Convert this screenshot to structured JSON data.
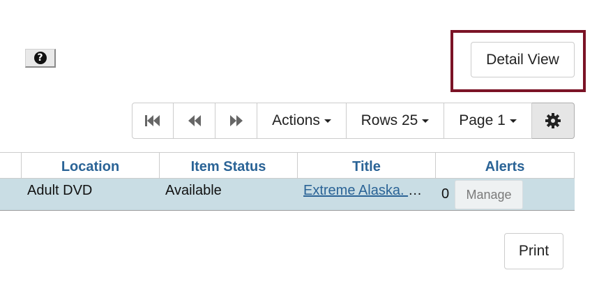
{
  "help": {
    "glyph": "?"
  },
  "detail_view": {
    "label": "Detail View"
  },
  "toolbar": {
    "first_icon": "first-page-icon",
    "prev_icon": "previous-page-icon",
    "next_icon": "next-page-icon",
    "actions_label": "Actions",
    "rows_label": "Rows 25",
    "page_label": "Page 1",
    "settings_icon": "gear-icon"
  },
  "grid": {
    "columns": [
      "Location",
      "Item Status",
      "Title",
      "Alerts"
    ],
    "rows": [
      {
        "location": "Adult DVD",
        "status": "Available",
        "title": "Extreme Alaska. ",
        "ellipsis": "…",
        "alerts": "0",
        "action": "Manage"
      }
    ]
  },
  "print": {
    "label": "Print"
  },
  "colors": {
    "highlight": "#7b1326",
    "link": "#2a6396",
    "row_bg": "#c9dde4"
  }
}
